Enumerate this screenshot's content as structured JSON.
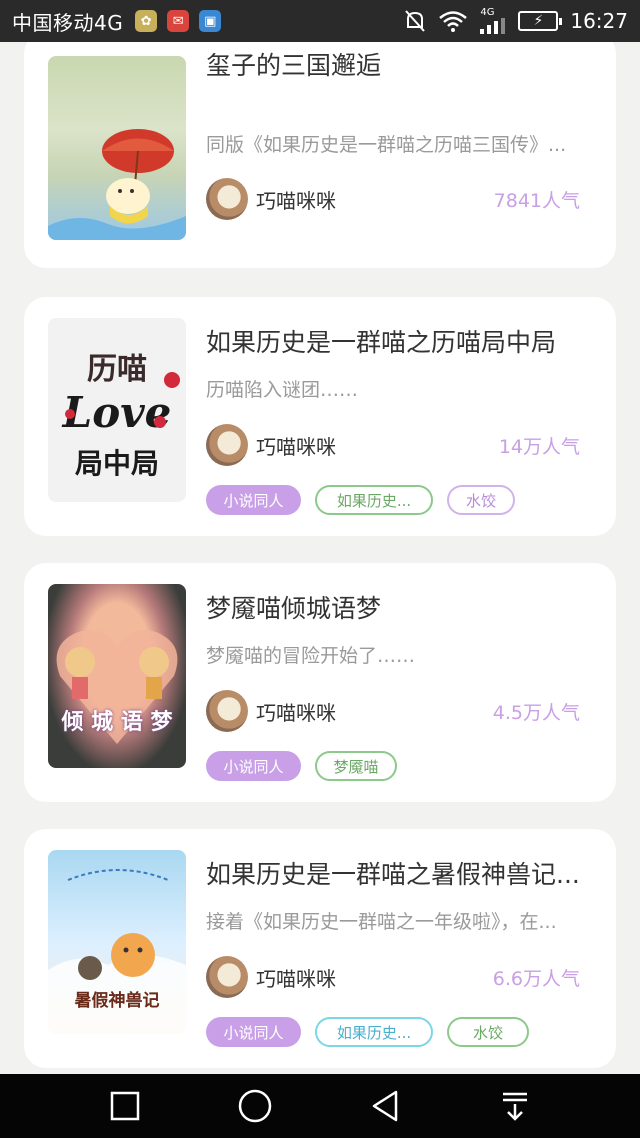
{
  "status_bar": {
    "carrier": "中国移动4G",
    "network": "4G",
    "time": "16:27"
  },
  "cards": [
    {
      "title": "玺子的三国邂逅",
      "description": "同版《如果历史是一群喵之历喵三国传》...",
      "author": "巧喵咪咪",
      "popularity": "7841人气",
      "tags": []
    },
    {
      "title": "如果历史是一群喵之历喵局中局",
      "description": "历喵陷入谜团……",
      "author": "巧喵咪咪",
      "popularity": "14万人气",
      "cover_text": [
        "历喵",
        "Love",
        "局中局"
      ],
      "tags": [
        "小说同人",
        "如果历史...",
        "水饺"
      ]
    },
    {
      "title": "梦魇喵倾城语梦",
      "description": "梦魇喵的冒险开始了……",
      "author": "巧喵咪咪",
      "popularity": "4.5万人气",
      "cover_text": [
        "倾 城 语 梦"
      ],
      "tags": [
        "小说同人",
        "梦魇喵"
      ]
    },
    {
      "title": "如果历史是一群喵之暑假神兽记...",
      "description": "接着《如果历史一群喵之一年级啦》，在...",
      "author": "巧喵咪咪",
      "popularity": "6.6万人气",
      "cover_text": [
        "暑假神兽记"
      ],
      "tags": [
        "小说同人",
        "如果历史...",
        "水饺"
      ]
    }
  ],
  "nav": {
    "icons": [
      "recents-square-icon",
      "home-circle-icon",
      "back-triangle-icon",
      "notification-pull-icon"
    ]
  },
  "colors": {
    "accent_purple": "#c9a0e8",
    "popularity": "#c8a0e4",
    "tag_green": "#8dc98a",
    "tag_cyan": "#7dd6e8"
  }
}
